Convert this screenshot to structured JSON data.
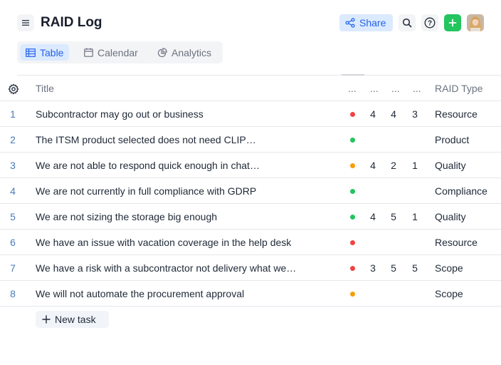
{
  "header": {
    "title": "RAID Log",
    "share_label": "Share",
    "accent": "#2563eb",
    "add_color": "#22c55e"
  },
  "tabs": [
    {
      "label": "Table",
      "icon": "table-icon",
      "active": true
    },
    {
      "label": "Calendar",
      "icon": "calendar-icon",
      "active": false
    },
    {
      "label": "Analytics",
      "icon": "analytics-icon",
      "active": false
    }
  ],
  "table": {
    "columns": {
      "title": "Title",
      "col1": "...",
      "col2": "...",
      "col3": "...",
      "col4": "...",
      "type": "RAID Type"
    },
    "rows": [
      {
        "num": "1",
        "title": "Subcontractor may go out or business",
        "status": "red",
        "v1": "4",
        "v2": "4",
        "v3": "3",
        "type": "Resource"
      },
      {
        "num": "2",
        "title": "The ITSM product selected does not need CLIP…",
        "status": "green",
        "v1": "",
        "v2": "",
        "v3": "",
        "type": "Product"
      },
      {
        "num": "3",
        "title": "We are not able to respond quick enough in chat…",
        "status": "orange",
        "v1": "4",
        "v2": "2",
        "v3": "1",
        "type": "Quality"
      },
      {
        "num": "4",
        "title": "We are not currently in full compliance with GDRP",
        "status": "green",
        "v1": "",
        "v2": "",
        "v3": "",
        "type": "Compliance"
      },
      {
        "num": "5",
        "title": "We are not sizing the storage big enough",
        "status": "green",
        "v1": "4",
        "v2": "5",
        "v3": "1",
        "type": "Quality"
      },
      {
        "num": "6",
        "title": "We have an issue with vacation coverage in the help desk",
        "status": "red",
        "v1": "",
        "v2": "",
        "v3": "",
        "type": "Resource"
      },
      {
        "num": "7",
        "title": "We have a risk with a subcontractor not delivery what we…",
        "status": "red",
        "v1": "3",
        "v2": "5",
        "v3": "5",
        "type": "Scope"
      },
      {
        "num": "8",
        "title": "We will not automate the procurement approval",
        "status": "orange",
        "v1": "",
        "v2": "",
        "v3": "",
        "type": "Scope"
      }
    ],
    "status_colors": {
      "red": "#ef4444",
      "green": "#22c55e",
      "orange": "#f59e0b"
    }
  },
  "new_task_label": "New task"
}
